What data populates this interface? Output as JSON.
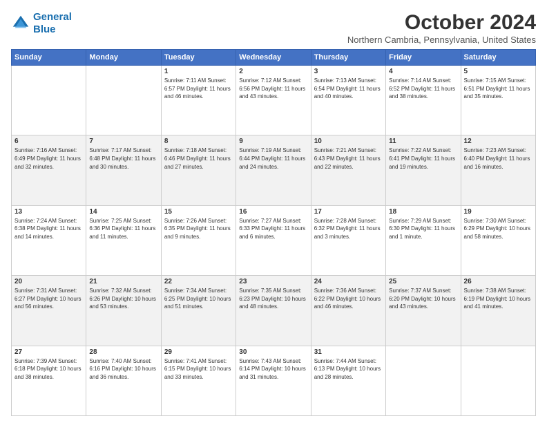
{
  "logo": {
    "line1": "General",
    "line2": "Blue"
  },
  "title": "October 2024",
  "subtitle": "Northern Cambria, Pennsylvania, United States",
  "days_of_week": [
    "Sunday",
    "Monday",
    "Tuesday",
    "Wednesday",
    "Thursday",
    "Friday",
    "Saturday"
  ],
  "weeks": [
    [
      {
        "day": "",
        "info": ""
      },
      {
        "day": "",
        "info": ""
      },
      {
        "day": "1",
        "info": "Sunrise: 7:11 AM\nSunset: 6:57 PM\nDaylight: 11 hours and 46 minutes."
      },
      {
        "day": "2",
        "info": "Sunrise: 7:12 AM\nSunset: 6:56 PM\nDaylight: 11 hours and 43 minutes."
      },
      {
        "day": "3",
        "info": "Sunrise: 7:13 AM\nSunset: 6:54 PM\nDaylight: 11 hours and 40 minutes."
      },
      {
        "day": "4",
        "info": "Sunrise: 7:14 AM\nSunset: 6:52 PM\nDaylight: 11 hours and 38 minutes."
      },
      {
        "day": "5",
        "info": "Sunrise: 7:15 AM\nSunset: 6:51 PM\nDaylight: 11 hours and 35 minutes."
      }
    ],
    [
      {
        "day": "6",
        "info": "Sunrise: 7:16 AM\nSunset: 6:49 PM\nDaylight: 11 hours and 32 minutes."
      },
      {
        "day": "7",
        "info": "Sunrise: 7:17 AM\nSunset: 6:48 PM\nDaylight: 11 hours and 30 minutes."
      },
      {
        "day": "8",
        "info": "Sunrise: 7:18 AM\nSunset: 6:46 PM\nDaylight: 11 hours and 27 minutes."
      },
      {
        "day": "9",
        "info": "Sunrise: 7:19 AM\nSunset: 6:44 PM\nDaylight: 11 hours and 24 minutes."
      },
      {
        "day": "10",
        "info": "Sunrise: 7:21 AM\nSunset: 6:43 PM\nDaylight: 11 hours and 22 minutes."
      },
      {
        "day": "11",
        "info": "Sunrise: 7:22 AM\nSunset: 6:41 PM\nDaylight: 11 hours and 19 minutes."
      },
      {
        "day": "12",
        "info": "Sunrise: 7:23 AM\nSunset: 6:40 PM\nDaylight: 11 hours and 16 minutes."
      }
    ],
    [
      {
        "day": "13",
        "info": "Sunrise: 7:24 AM\nSunset: 6:38 PM\nDaylight: 11 hours and 14 minutes."
      },
      {
        "day": "14",
        "info": "Sunrise: 7:25 AM\nSunset: 6:36 PM\nDaylight: 11 hours and 11 minutes."
      },
      {
        "day": "15",
        "info": "Sunrise: 7:26 AM\nSunset: 6:35 PM\nDaylight: 11 hours and 9 minutes."
      },
      {
        "day": "16",
        "info": "Sunrise: 7:27 AM\nSunset: 6:33 PM\nDaylight: 11 hours and 6 minutes."
      },
      {
        "day": "17",
        "info": "Sunrise: 7:28 AM\nSunset: 6:32 PM\nDaylight: 11 hours and 3 minutes."
      },
      {
        "day": "18",
        "info": "Sunrise: 7:29 AM\nSunset: 6:30 PM\nDaylight: 11 hours and 1 minute."
      },
      {
        "day": "19",
        "info": "Sunrise: 7:30 AM\nSunset: 6:29 PM\nDaylight: 10 hours and 58 minutes."
      }
    ],
    [
      {
        "day": "20",
        "info": "Sunrise: 7:31 AM\nSunset: 6:27 PM\nDaylight: 10 hours and 56 minutes."
      },
      {
        "day": "21",
        "info": "Sunrise: 7:32 AM\nSunset: 6:26 PM\nDaylight: 10 hours and 53 minutes."
      },
      {
        "day": "22",
        "info": "Sunrise: 7:34 AM\nSunset: 6:25 PM\nDaylight: 10 hours and 51 minutes."
      },
      {
        "day": "23",
        "info": "Sunrise: 7:35 AM\nSunset: 6:23 PM\nDaylight: 10 hours and 48 minutes."
      },
      {
        "day": "24",
        "info": "Sunrise: 7:36 AM\nSunset: 6:22 PM\nDaylight: 10 hours and 46 minutes."
      },
      {
        "day": "25",
        "info": "Sunrise: 7:37 AM\nSunset: 6:20 PM\nDaylight: 10 hours and 43 minutes."
      },
      {
        "day": "26",
        "info": "Sunrise: 7:38 AM\nSunset: 6:19 PM\nDaylight: 10 hours and 41 minutes."
      }
    ],
    [
      {
        "day": "27",
        "info": "Sunrise: 7:39 AM\nSunset: 6:18 PM\nDaylight: 10 hours and 38 minutes."
      },
      {
        "day": "28",
        "info": "Sunrise: 7:40 AM\nSunset: 6:16 PM\nDaylight: 10 hours and 36 minutes."
      },
      {
        "day": "29",
        "info": "Sunrise: 7:41 AM\nSunset: 6:15 PM\nDaylight: 10 hours and 33 minutes."
      },
      {
        "day": "30",
        "info": "Sunrise: 7:43 AM\nSunset: 6:14 PM\nDaylight: 10 hours and 31 minutes."
      },
      {
        "day": "31",
        "info": "Sunrise: 7:44 AM\nSunset: 6:13 PM\nDaylight: 10 hours and 28 minutes."
      },
      {
        "day": "",
        "info": ""
      },
      {
        "day": "",
        "info": ""
      }
    ]
  ]
}
